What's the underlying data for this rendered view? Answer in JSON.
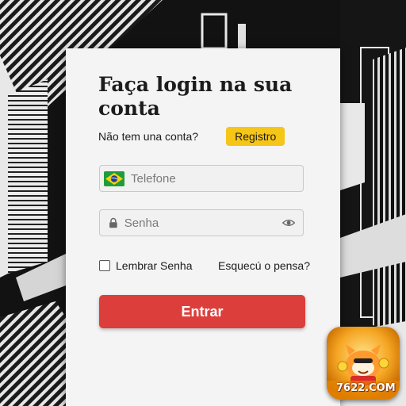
{
  "login": {
    "title": "Faça login na sua conta",
    "signup_prompt": "Não tem una conta?",
    "register_label": "Registro",
    "phone_placeholder": "Telefone",
    "password_placeholder": "Senha",
    "remember_label": "Lembrar Senha",
    "forgot_label": "Esquecú o pensa?",
    "submit_label": "Entrar"
  },
  "badge": {
    "text": "7622.COM"
  },
  "icons": {
    "flag": "brazil-flag-icon",
    "lock": "lock-icon",
    "eye": "eye-icon"
  },
  "colors": {
    "register_button": "#f5c518",
    "submit_button": "#dc3f3b",
    "card": "#f4f4f4"
  }
}
